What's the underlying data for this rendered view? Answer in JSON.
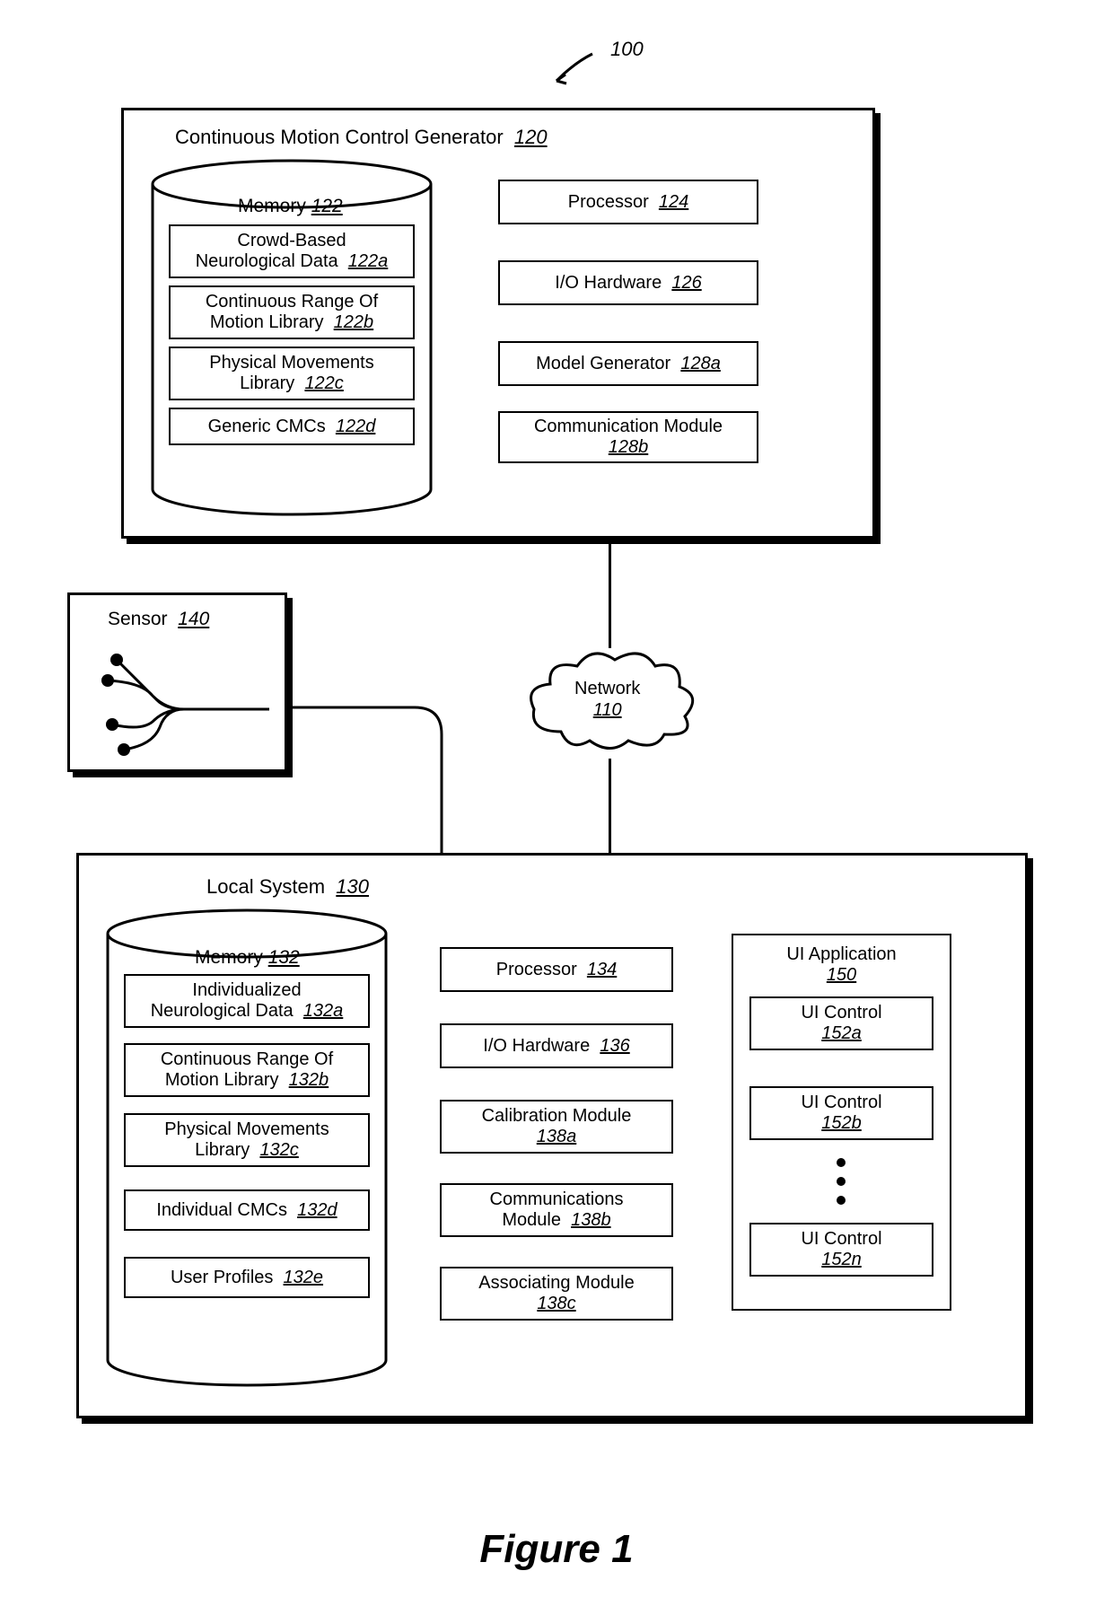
{
  "figure_ref": "100",
  "figure_title": "Figure 1",
  "cmcg": {
    "title": "Continuous Motion Control Generator",
    "ref": "120",
    "memory": {
      "title": "Memory",
      "ref": "122"
    },
    "mem_items": [
      {
        "t1": "Crowd-Based",
        "t2": "Neurological Data",
        "ref": "122a"
      },
      {
        "t1": "Continuous Range Of",
        "t2": "Motion Library",
        "ref": "122b"
      },
      {
        "t1": "Physical Movements",
        "t2": "Library",
        "ref": "122c"
      },
      {
        "t1": "Generic CMCs",
        "t2": "",
        "ref": "122d"
      }
    ],
    "right_items": [
      {
        "t1": "Processor",
        "ref": "124"
      },
      {
        "t1": "I/O Hardware",
        "ref": "126"
      },
      {
        "t1": "Model Generator",
        "ref": "128a"
      },
      {
        "t1": "Communication Module",
        "t2": "",
        "ref": "128b"
      }
    ]
  },
  "sensor": {
    "title": "Sensor",
    "ref": "140"
  },
  "network": {
    "title": "Network",
    "ref": "110"
  },
  "local": {
    "title": "Local System",
    "ref": "130",
    "memory": {
      "title": "Memory",
      "ref": "132"
    },
    "mem_items": [
      {
        "t1": "Individualized",
        "t2": "Neurological Data",
        "ref": "132a"
      },
      {
        "t1": "Continuous Range Of",
        "t2": "Motion Library",
        "ref": "132b"
      },
      {
        "t1": "Physical Movements",
        "t2": "Library",
        "ref": "132c"
      },
      {
        "t1": "Individual CMCs",
        "ref": "132d"
      },
      {
        "t1": "User Profiles",
        "ref": "132e"
      }
    ],
    "mid_items": [
      {
        "t1": "Processor",
        "ref": "134"
      },
      {
        "t1": "I/O Hardware",
        "ref": "136"
      },
      {
        "t1": "Calibration Module",
        "t2": "",
        "ref": "138a"
      },
      {
        "t1": "Communications",
        "t2": "Module",
        "ref": "138b"
      },
      {
        "t1": "Associating Module",
        "t2": "",
        "ref": "138c"
      }
    ],
    "ui_app": {
      "title": "UI Application",
      "ref": "150"
    },
    "ui_controls": [
      {
        "t1": "UI Control",
        "ref": "152a"
      },
      {
        "t1": "UI Control",
        "ref": "152b"
      },
      {
        "t1": "UI Control",
        "ref": "152n"
      }
    ]
  }
}
